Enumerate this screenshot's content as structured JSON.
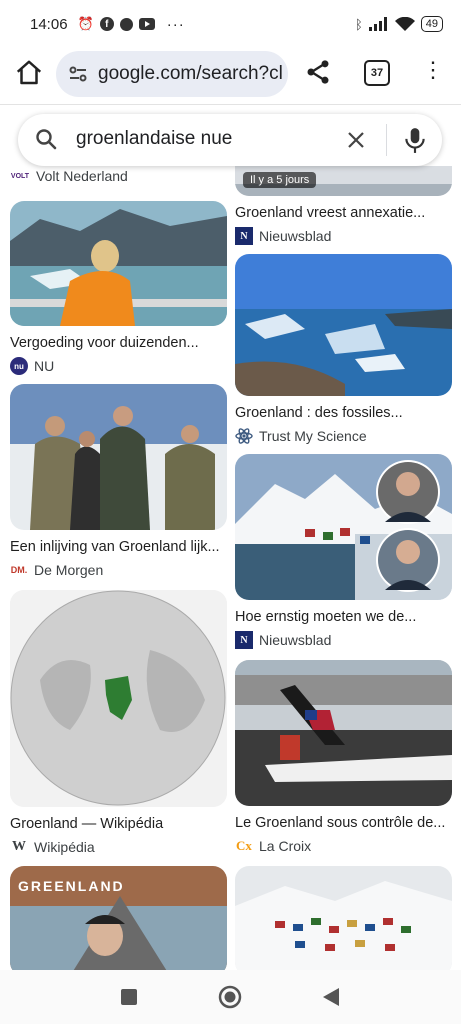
{
  "status_bar": {
    "time": "14:06",
    "battery": "49",
    "left_icons": [
      "alarm-icon",
      "facebook-icon",
      "messenger-icon",
      "youtube-icon",
      "more-dots-icon"
    ],
    "right_icons": [
      "bluetooth-icon",
      "signal-icon",
      "wifi-icon",
      "battery-icon"
    ]
  },
  "browser": {
    "url": "google.com/search?cl",
    "tab_count": "37"
  },
  "search": {
    "query": "groenlandaise nue"
  },
  "results": [
    {
      "title": "",
      "source": "Volt Nederland",
      "favicon": "VOLT"
    },
    {
      "title": "Vergoeding voor duizenden...",
      "source": "NU",
      "favicon": "nu"
    },
    {
      "title": "Een inlijving van Groenland lijk...",
      "source": "De Morgen",
      "favicon": "DM."
    },
    {
      "title": "Groenland — Wikipédia",
      "source": "Wikipédia",
      "favicon": "W"
    },
    {
      "title": "",
      "source": "",
      "favicon": "",
      "overlay_title": "GREENLAND"
    },
    {
      "title": "Groenland vreest annexatie...",
      "source": "Nieuwsblad",
      "favicon": "N",
      "badge": "Il y a 5 jours"
    },
    {
      "title": "Groenland : des fossiles...",
      "source": "Trust My Science",
      "favicon": "atom"
    },
    {
      "title": "Hoe ernstig moeten we de...",
      "source": "Nieuwsblad",
      "favicon": "N"
    },
    {
      "title": "Le Groenland sous contrôle de...",
      "source": "La Croix",
      "favicon": "Cx"
    },
    {
      "title": "",
      "source": "",
      "favicon": ""
    }
  ],
  "colors": {
    "accent_blue": "#0b57d0",
    "urlbar_bg": "#e9ecf4",
    "nieuwsblad_blue": "#1a2a6c",
    "lacroix_orange": "#f39c12"
  }
}
